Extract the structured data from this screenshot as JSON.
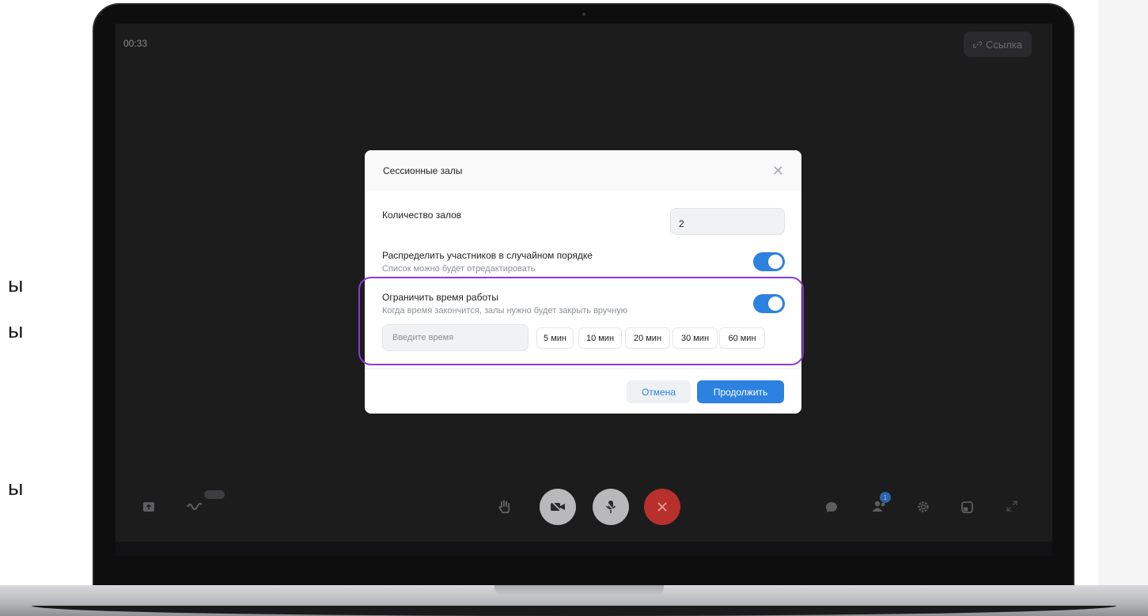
{
  "side_text": [
    "ы",
    "ы",
    "ы"
  ],
  "call": {
    "timer": "00:33",
    "link_label": "Ссылка",
    "participants_count": "1"
  },
  "modal": {
    "title": "Сессионные залы",
    "rooms_count_label": "Количество залов",
    "rooms_count_value": "2",
    "random_label": "Распределить участников в случайном порядке",
    "random_hint": "Список можно будет отредактировать",
    "random_enabled": true,
    "limit_label": "Ограничить время работы",
    "limit_hint": "Когда время закончится, залы нужно будет закрыть вручную",
    "limit_enabled": true,
    "time_placeholder": "Введите время",
    "presets": [
      "5 мин",
      "10 мин",
      "20 мин",
      "30 мин",
      "60 мин"
    ],
    "cancel_label": "Отмена",
    "continue_label": "Продолжить"
  },
  "colors": {
    "accent": "#2d81e0",
    "highlight": "#8a3bd1",
    "end_call": "#b8302b"
  }
}
